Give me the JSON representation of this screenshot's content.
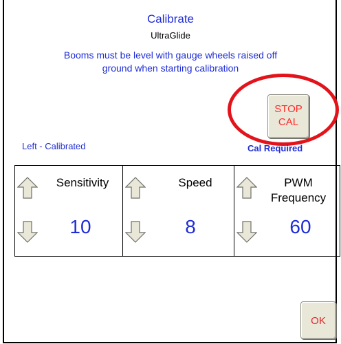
{
  "header": {
    "title": "Calibrate",
    "subtitle": "UltraGlide",
    "instruction_line1": "Booms must be level with gauge wheels raised off",
    "instruction_line2": "ground when starting calibration"
  },
  "buttons": {
    "stop_line1": "STOP",
    "stop_line2": "CAL",
    "ok": "OK"
  },
  "status": {
    "left": "Left - Calibrated",
    "right": "Cal Required"
  },
  "settings": [
    {
      "label_line1": "Sensitivity",
      "label_line2": "",
      "value": "10"
    },
    {
      "label_line1": "Speed",
      "label_line2": "",
      "value": "8"
    },
    {
      "label_line1": "PWM",
      "label_line2": "Frequency",
      "value": "60"
    }
  ],
  "colors": {
    "text_blue": "#1f2dd6",
    "stop_red": "#ff2a2a",
    "highlight_red": "#e3131b",
    "button_face": "#e9e7d8"
  },
  "icons": {
    "up": "arrow-up-icon",
    "down": "arrow-down-icon"
  }
}
